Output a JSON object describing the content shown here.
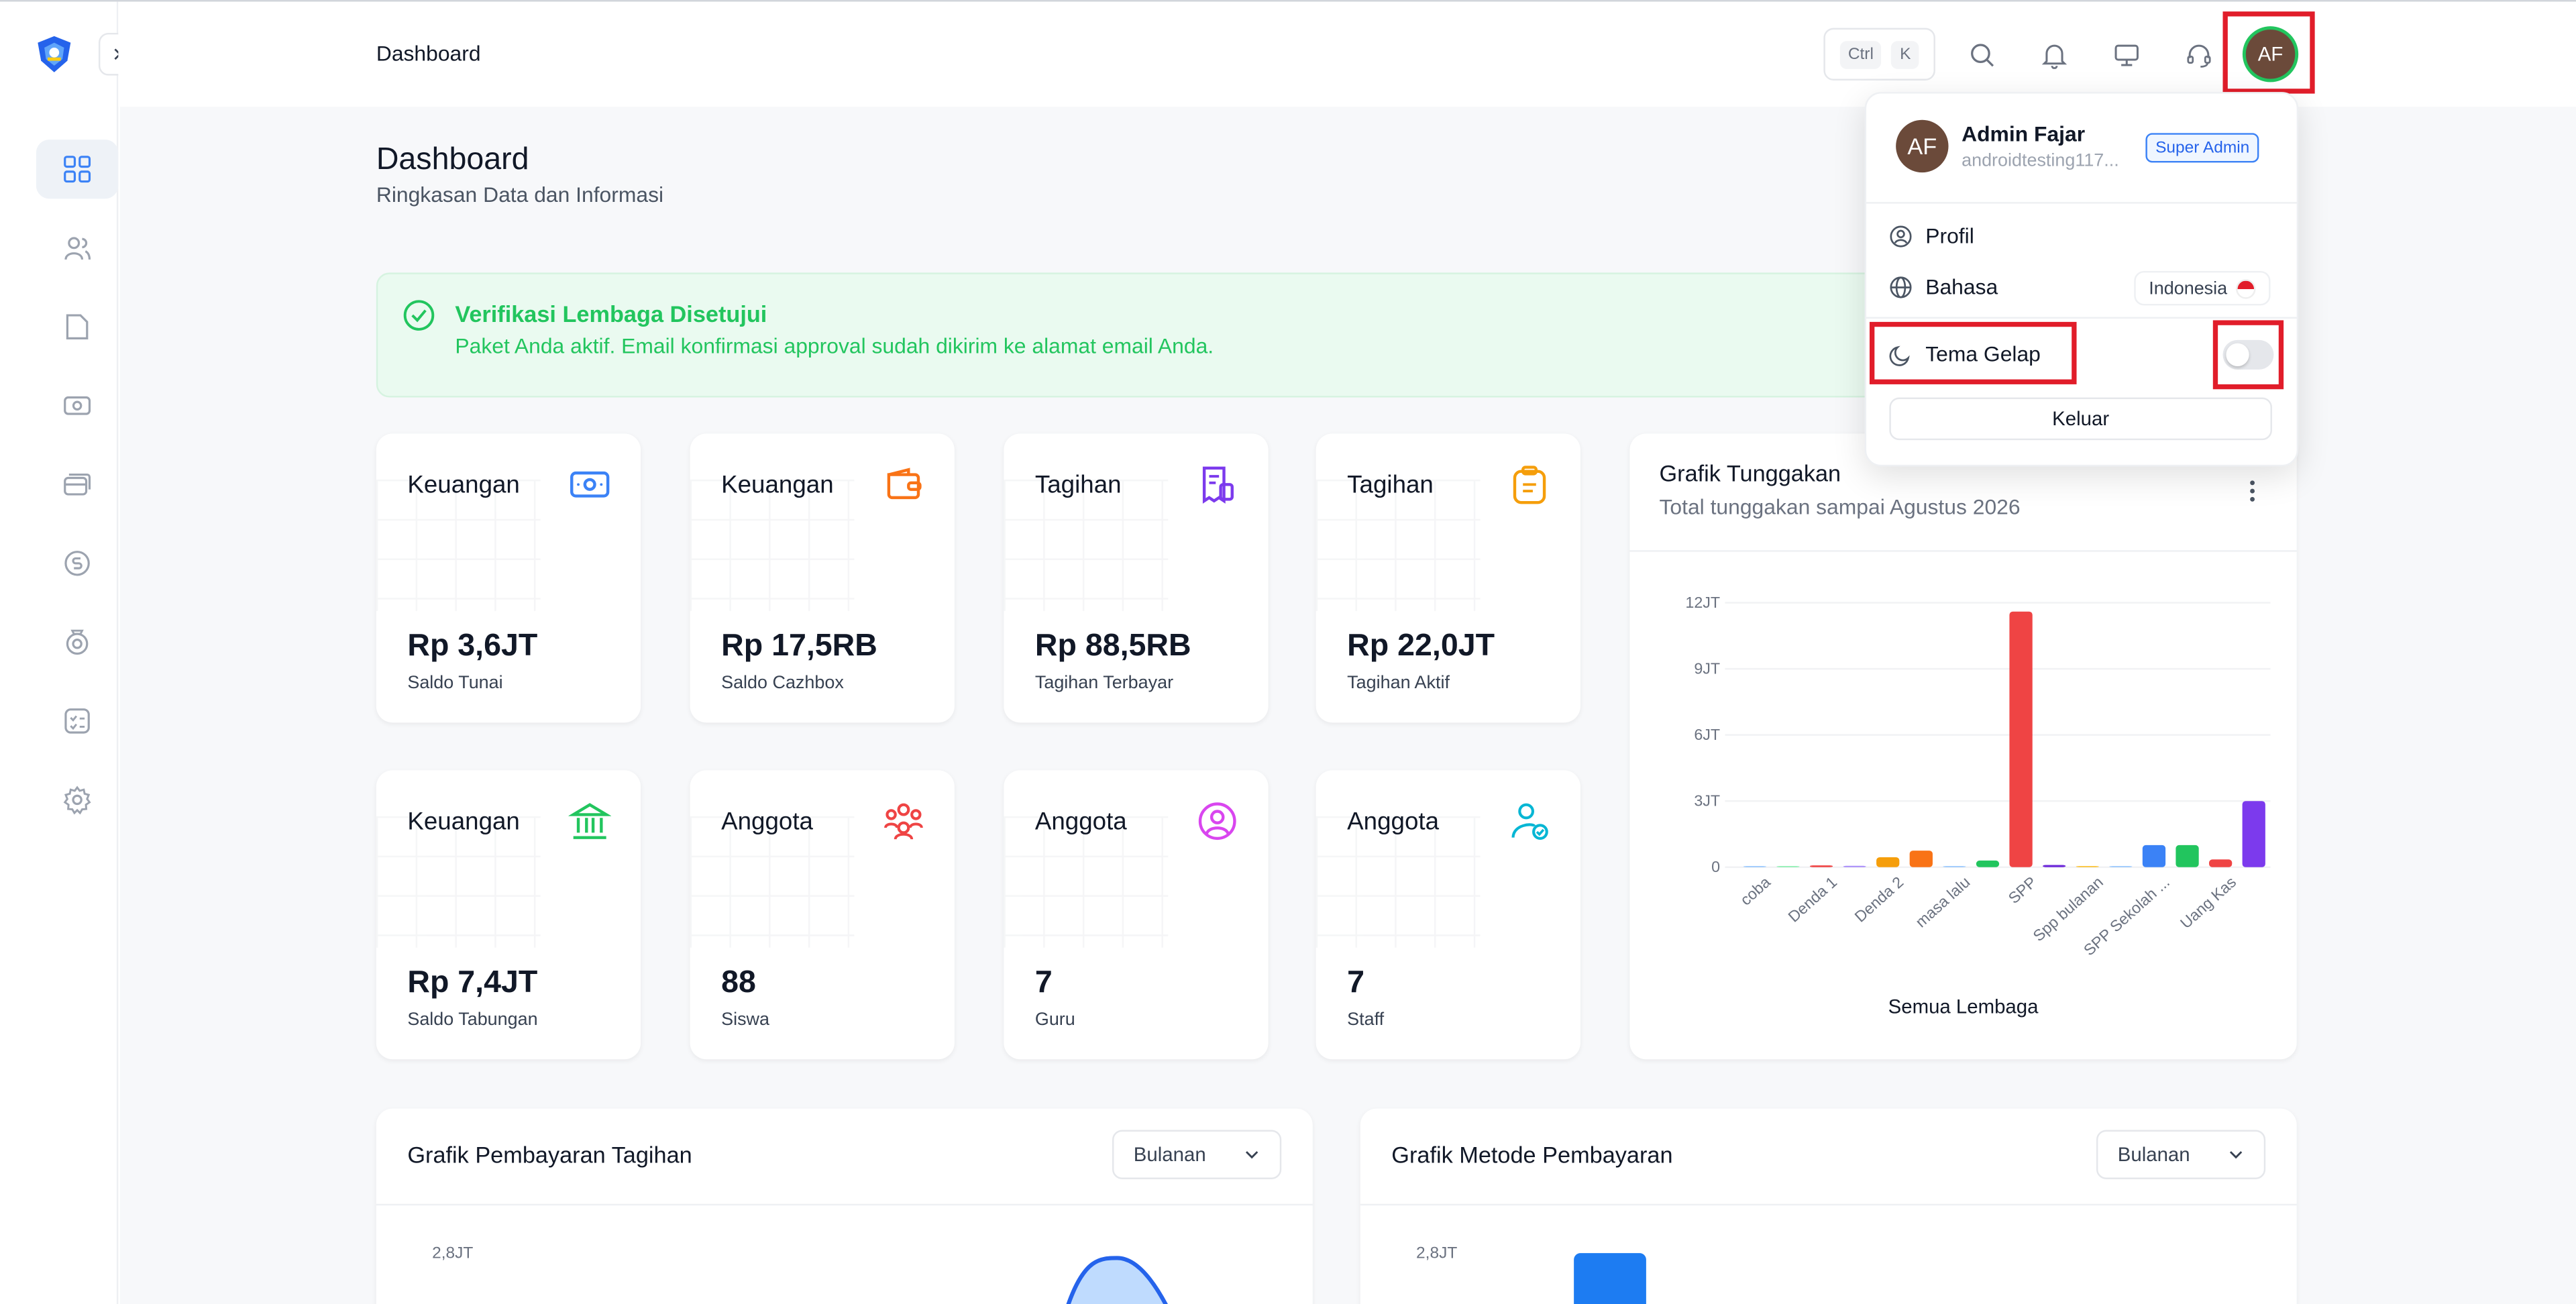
{
  "header": {
    "title": "Dashboard",
    "shortcut_keys": [
      "Ctrl",
      "K"
    ]
  },
  "page": {
    "title": "Dashboard",
    "subtitle": "Ringkasan Data dan Informasi"
  },
  "alert": {
    "title": "Verifikasi Lembaga Disetujui",
    "message": "Paket Anda aktif. Email konfirmasi approval sudah dikirim ke alamat email Anda.",
    "color": "#22c55e"
  },
  "cards": [
    {
      "label": "Keuangan",
      "value": "Rp 3,6JT",
      "sub": "Saldo Tunai",
      "icon": "cash-icon",
      "color": "#3b82f6"
    },
    {
      "label": "Keuangan",
      "value": "Rp 17,5RB",
      "sub": "Saldo Cazhbox",
      "icon": "wallet-icon",
      "color": "#f97316"
    },
    {
      "label": "Tagihan",
      "value": "Rp 88,5RB",
      "sub": "Tagihan Terbayar",
      "icon": "receipt-icon",
      "color": "#7c3aed"
    },
    {
      "label": "Tagihan",
      "value": "Rp 22,0JT",
      "sub": "Tagihan Aktif",
      "icon": "clipboard-icon",
      "color": "#f59e0b"
    },
    {
      "label": "Keuangan",
      "value": "Rp 7,4JT",
      "sub": "Saldo Tabungan",
      "icon": "bank-icon",
      "color": "#22c55e"
    },
    {
      "label": "Anggota",
      "value": "88",
      "sub": "Siswa",
      "icon": "users-group-icon",
      "color": "#ef4444"
    },
    {
      "label": "Anggota",
      "value": "7",
      "sub": "Guru",
      "icon": "user-circle-icon",
      "color": "#d946ef"
    },
    {
      "label": "Anggota",
      "value": "7",
      "sub": "Staff",
      "icon": "user-check-icon",
      "color": "#06b6d4"
    }
  ],
  "arrears_chart": {
    "title": "Grafik Tunggakan",
    "subtitle": "Total tunggakan sampai Agustus 2026",
    "footer": "Semua Lembaga"
  },
  "chart_data": {
    "type": "bar",
    "categories": [
      "coba",
      "Denda 1",
      "Denda 2",
      "masa lalu",
      "SPP",
      "Spp bulanan",
      "SPP Sekolah ...",
      "Uang Kas"
    ],
    "values": [
      0.01,
      0.03,
      0.07,
      0.06,
      11.6,
      0.08,
      0.09,
      3.0
    ],
    "extra_bars": [
      {
        "value": 0.02,
        "color": "#4ade80"
      },
      {
        "value": 0.45,
        "color": "#f59e0b"
      },
      {
        "value": 0.75,
        "color": "#f97316"
      },
      {
        "value": 0.02,
        "color": "#60a5fa"
      },
      {
        "value": 0.3,
        "color": "#22c55e"
      },
      {
        "value": 0.1,
        "color": "#7c3aed"
      },
      {
        "value": 0.02,
        "color": "#fbbf24"
      },
      {
        "value": 1.0,
        "color": "#3b82f6"
      },
      {
        "value": 1.0,
        "color": "#22c55e"
      },
      {
        "value": 0.35,
        "color": "#ef4444"
      }
    ],
    "bars": [
      {
        "value": 0.02,
        "color": "#93c5fd"
      },
      {
        "value": 0.02,
        "color": "#86efac"
      },
      {
        "value": 0.08,
        "color": "#ef4444"
      },
      {
        "value": 0.06,
        "color": "#a78bfa"
      },
      {
        "value": 0.45,
        "color": "#f59e0b"
      },
      {
        "value": 0.75,
        "color": "#f97316"
      },
      {
        "value": 0.02,
        "color": "#93c5fd"
      },
      {
        "value": 0.3,
        "color": "#22c55e"
      },
      {
        "value": 11.6,
        "color": "#ef4444"
      },
      {
        "value": 0.1,
        "color": "#6d28d9"
      },
      {
        "value": 0.03,
        "color": "#fbbf24"
      },
      {
        "value": 0.02,
        "color": "#93c5fd"
      },
      {
        "value": 1.0,
        "color": "#3b82f6"
      },
      {
        "value": 1.0,
        "color": "#22c55e"
      },
      {
        "value": 0.35,
        "color": "#ef4444"
      },
      {
        "value": 3.0,
        "color": "#7c3aed"
      }
    ],
    "xlabels": [
      {
        "label": "coba",
        "bar": 1
      },
      {
        "label": "Denda 1",
        "bar": 3
      },
      {
        "label": "Denda 2",
        "bar": 5
      },
      {
        "label": "masa lalu",
        "bar": 7
      },
      {
        "label": "SPP",
        "bar": 9
      },
      {
        "label": "Spp bulanan",
        "bar": 11
      },
      {
        "label": "SPP Sekolah ...",
        "bar": 13
      },
      {
        "label": "Uang Kas",
        "bar": 15
      }
    ],
    "ylim": [
      0,
      12
    ],
    "yticks": [
      {
        "value": 0,
        "label": "0"
      },
      {
        "value": 3,
        "label": "3JT"
      },
      {
        "value": 6,
        "label": "6JT"
      },
      {
        "value": 9,
        "label": "9JT"
      },
      {
        "value": 12,
        "label": "12JT"
      }
    ],
    "xlabel": "Semua Lembaga",
    "unit": "JT"
  },
  "bottom": {
    "payments": {
      "title": "Grafik Pembayaran Tagihan",
      "select": "Bulanan",
      "tick": "2,8JT"
    },
    "methods": {
      "title": "Grafik Metode Pembayaran",
      "select": "Bulanan",
      "tick": "2,8JT"
    }
  },
  "user_menu": {
    "initials": "AF",
    "name": "Admin Fajar",
    "email": "androidtesting117...",
    "role": "Super Admin",
    "items": {
      "profile": "Profil",
      "language": "Bahasa",
      "language_value": "Indonesia",
      "theme": "Tema Gelap",
      "logout": "Keluar"
    },
    "dark_theme_enabled": false
  },
  "sidebar": {
    "items": [
      "dashboard-icon",
      "users-icon",
      "folder-icon",
      "cash-icon",
      "card-icon",
      "finance-icon",
      "savings-icon",
      "checklist-icon",
      "settings-icon"
    ]
  }
}
